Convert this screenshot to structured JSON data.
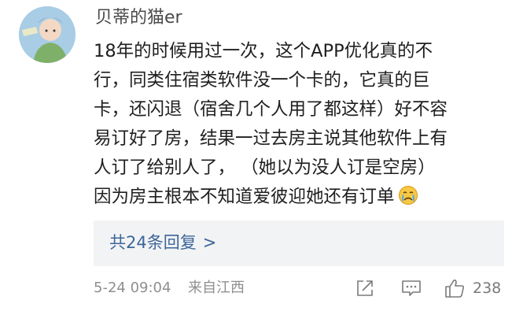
{
  "comment": {
    "author": "贝蒂的猫er",
    "avatar_icon": "avatar-illustration",
    "lines": [
      "18年的时候用过一次，这个APP优化真的不",
      "行，同类住宿类软件没一个卡的，它真的巨",
      "卡，还闪退（宿舍几个人用了都这样）好不容",
      "易订好了房，结果一过去房主说其他软件上有",
      "人订了给别人了，  （她以为没人订是空房）",
      "因为房主根本不知道爱彼迎她还有订单"
    ],
    "trailing_emoji": "crying-face-emoji",
    "replies_label": "共24条回复",
    "replies_chevron": ">",
    "timestamp": "5-24 09:04",
    "location": "来自江西",
    "like_count": "238"
  },
  "colors": {
    "text": "#1f1f1f",
    "username": "#4a4a4a",
    "link": "#3d6699",
    "meta": "#8f8f8f",
    "reply_bg": "#f2f3f5",
    "icon": "#7a7a7a"
  }
}
